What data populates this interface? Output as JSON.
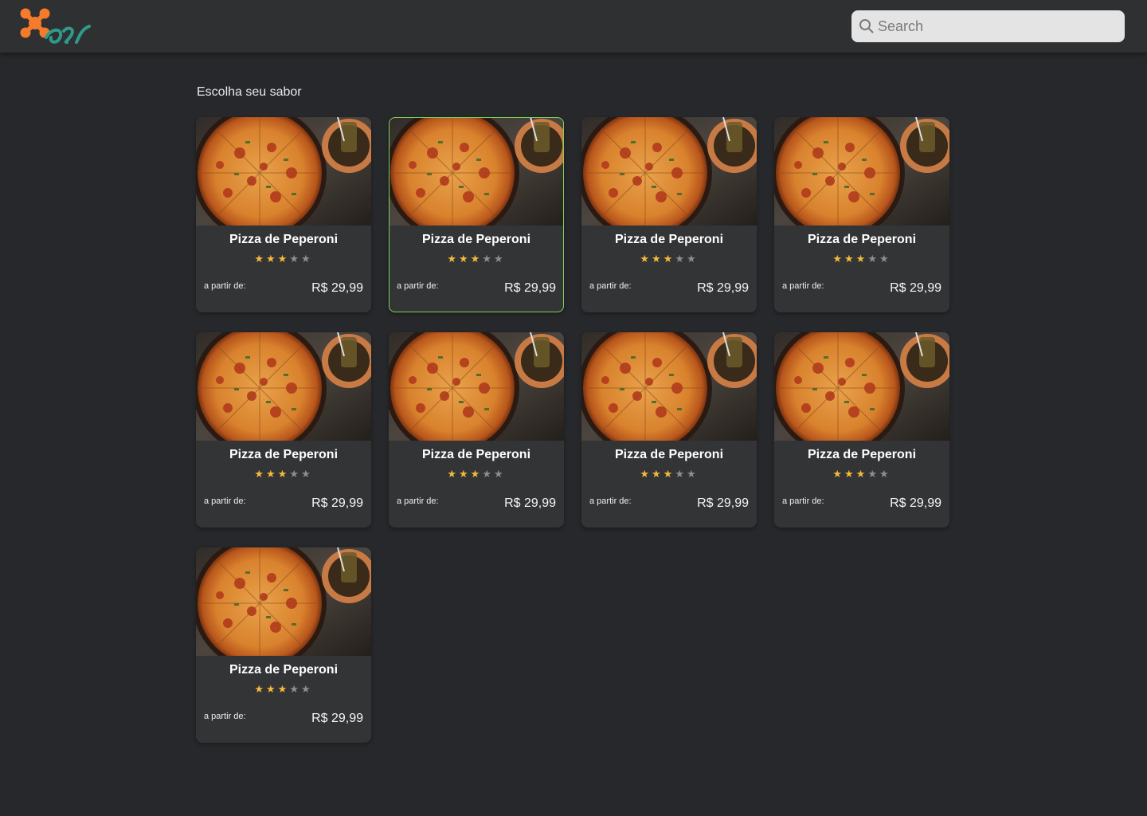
{
  "header": {
    "logo_alt": "logo",
    "search": {
      "placeholder": "Search",
      "value": ""
    }
  },
  "main": {
    "title": "Escolha seu sabor",
    "products": [
      {
        "name": "Pizza de Peperoni",
        "rating": 3,
        "max_rating": 5,
        "price_label": "a partir de:",
        "price": "R$ 29,99",
        "selected": false
      },
      {
        "name": "Pizza de Peperoni",
        "rating": 3,
        "max_rating": 5,
        "price_label": "a partir de:",
        "price": "R$ 29,99",
        "selected": true
      },
      {
        "name": "Pizza de Peperoni",
        "rating": 3,
        "max_rating": 5,
        "price_label": "a partir de:",
        "price": "R$ 29,99",
        "selected": false
      },
      {
        "name": "Pizza de Peperoni",
        "rating": 3,
        "max_rating": 5,
        "price_label": "a partir de:",
        "price": "R$ 29,99",
        "selected": false
      },
      {
        "name": "Pizza de Peperoni",
        "rating": 3,
        "max_rating": 5,
        "price_label": "a partir de:",
        "price": "R$ 29,99",
        "selected": false
      },
      {
        "name": "Pizza de Peperoni",
        "rating": 3,
        "max_rating": 5,
        "price_label": "a partir de:",
        "price": "R$ 29,99",
        "selected": false
      },
      {
        "name": "Pizza de Peperoni",
        "rating": 3,
        "max_rating": 5,
        "price_label": "a partir de:",
        "price": "R$ 29,99",
        "selected": false
      },
      {
        "name": "Pizza de Peperoni",
        "rating": 3,
        "max_rating": 5,
        "price_label": "a partir de:",
        "price": "R$ 29,99",
        "selected": false
      },
      {
        "name": "Pizza de Peperoni",
        "rating": 3,
        "max_rating": 5,
        "price_label": "a partir de:",
        "price": "R$ 29,99",
        "selected": false
      }
    ]
  },
  "colors": {
    "background": "#26282b",
    "header": "#2f3032",
    "card": "#333436",
    "accent_star": "#f6b93b",
    "selected_border": "#7fd35b",
    "logo_orange": "#f47a2c",
    "logo_teal": "#2e9a8c"
  },
  "icons": {
    "logo": "logo-icon",
    "search": "search-icon",
    "product_image": "pizza-image",
    "star": "star-icon"
  }
}
